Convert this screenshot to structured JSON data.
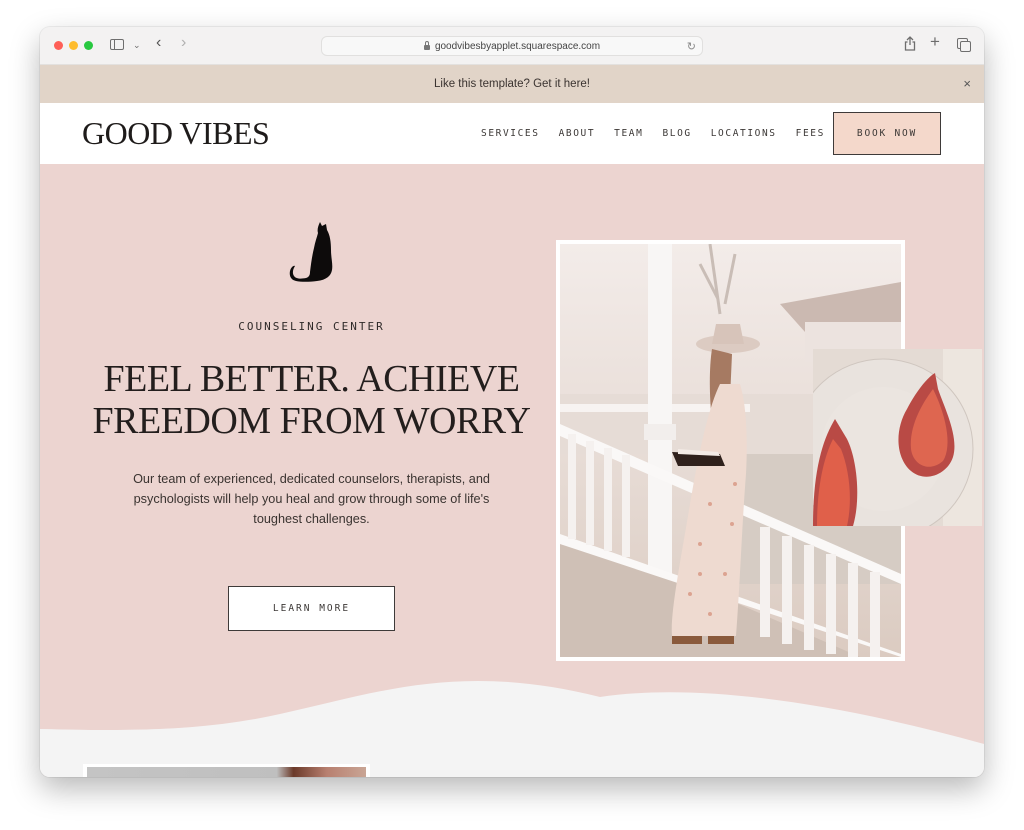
{
  "browser": {
    "url": "goodvibesbyapplet.squarespace.com",
    "icons": [
      "sidebar-toggle-icon",
      "chevron-down-icon",
      "back-icon",
      "forward-icon",
      "lock-icon",
      "reload-icon",
      "share-icon",
      "new-tab-icon",
      "tab-overview-icon"
    ],
    "glyphs": {
      "back": "‹",
      "forward": "›",
      "chevron": "⌄",
      "reload": "↻",
      "share": "⇪",
      "new_tab": "+",
      "close": "×"
    }
  },
  "announcement": {
    "text": "Like this template? Get it here!"
  },
  "header": {
    "logo": "GOOD VIBES",
    "nav": [
      {
        "label": "SERVICES"
      },
      {
        "label": "ABOUT"
      },
      {
        "label": "TEAM"
      },
      {
        "label": "BLOG"
      },
      {
        "label": "LOCATIONS"
      },
      {
        "label": "FEES"
      }
    ],
    "cta_label": "BOOK NOW"
  },
  "hero": {
    "eyebrow": "COUNSELING CENTER",
    "headline_line1": "FEEL BETTER. ACHIEVE",
    "headline_line2": "FREEDOM FROM WORRY",
    "lede": "Our team of experienced, dedicated counselors, therapists, and psychologists will help you heal and grow through some of life's toughest challenges.",
    "cta_label": "LEARN MORE",
    "images": {
      "main": "woman reading a book on a white porch",
      "secondary": "halved figs on a plate"
    }
  },
  "colors": {
    "announcement_bg": "#e1d4c8",
    "hero_bg": "#ecd4d0",
    "book_button_bg": "#f4d8cb",
    "lower_bg": "#f4f4f4",
    "text_dark": "#231e1d"
  }
}
